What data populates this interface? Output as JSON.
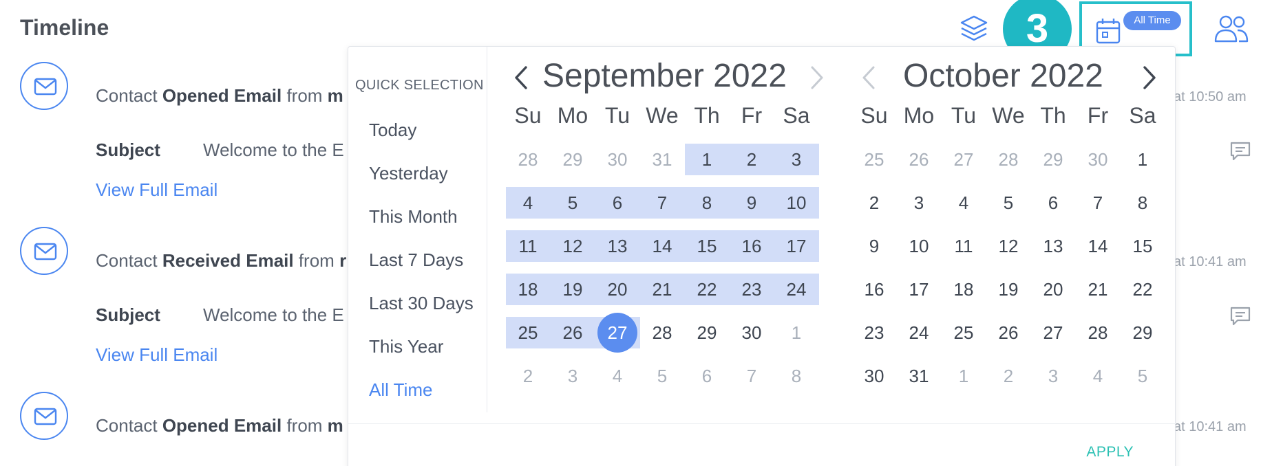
{
  "header": {
    "title": "Timeline",
    "step_number": "3",
    "date_filter_badge": "All Time",
    "icons": [
      "layers-icon",
      "calendar-icon",
      "people-icon"
    ],
    "accent_color": "#26bfca"
  },
  "timeline": [
    {
      "prefix": "Contact ",
      "action": "Opened Email",
      "suffix": " from ",
      "sender_initial": "m",
      "time": "at 10:50 am",
      "subject_label": "Subject",
      "subject_value": "Welcome to the E",
      "link": "View Full Email"
    },
    {
      "prefix": "Contact ",
      "action": "Received Email",
      "suffix": " from ",
      "sender_initial": "r",
      "time": "at 10:41 am",
      "subject_label": "Subject",
      "subject_value": "Welcome to the E",
      "link": "View Full Email"
    },
    {
      "prefix": "Contact ",
      "action": "Opened Email",
      "suffix": " from ",
      "sender_initial": "m",
      "time": "at 10:41 am"
    }
  ],
  "picker": {
    "quick_selection_title": "QUICK SELECTION",
    "quick_options": [
      "Today",
      "Yesterday",
      "This Month",
      "Last 7 Days",
      "Last 30 Days",
      "This Year",
      "All Time"
    ],
    "active_option": "All Time",
    "weekdays": [
      "Su",
      "Mo",
      "Tu",
      "We",
      "Th",
      "Fr",
      "Sa"
    ],
    "apply_label": "APPLY",
    "months": [
      {
        "title": "September 2022",
        "weeks": [
          [
            "28",
            "29",
            "30",
            "31",
            "1",
            "2",
            "3"
          ],
          [
            "4",
            "5",
            "6",
            "7",
            "8",
            "9",
            "10"
          ],
          [
            "11",
            "12",
            "13",
            "14",
            "15",
            "16",
            "17"
          ],
          [
            "18",
            "19",
            "20",
            "21",
            "22",
            "23",
            "24"
          ],
          [
            "25",
            "26",
            "27",
            "28",
            "29",
            "30",
            "1"
          ],
          [
            "2",
            "3",
            "4",
            "5",
            "6",
            "7",
            "8"
          ]
        ],
        "range_start_day": "1",
        "selected_day": "27"
      },
      {
        "title": "October 2022",
        "weeks": [
          [
            "25",
            "26",
            "27",
            "28",
            "29",
            "30",
            "1"
          ],
          [
            "2",
            "3",
            "4",
            "5",
            "6",
            "7",
            "8"
          ],
          [
            "9",
            "10",
            "11",
            "12",
            "13",
            "14",
            "15"
          ],
          [
            "16",
            "17",
            "18",
            "19",
            "20",
            "21",
            "22"
          ],
          [
            "23",
            "24",
            "25",
            "26",
            "27",
            "28",
            "29"
          ],
          [
            "30",
            "31",
            "1",
            "2",
            "3",
            "4",
            "5"
          ]
        ]
      }
    ]
  }
}
